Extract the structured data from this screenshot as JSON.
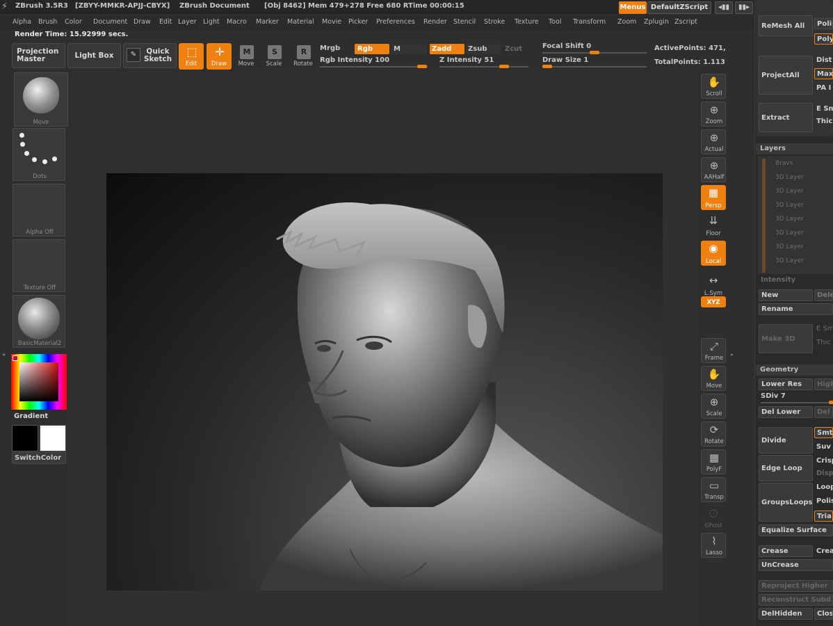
{
  "titlebar": {
    "app": "ZBrush 3.5R3",
    "serial": "[ZBYY-MMKR-APJJ-CBYX]",
    "document": "ZBrush Document",
    "stats": "[Obj 8462] Mem 479+278 Free 680 RTime 00:00:15",
    "menus_label": "Menus",
    "script_label": "DefaultZScript"
  },
  "menubar": [
    "Alpha",
    "Brush",
    "Color",
    "Document",
    "Draw",
    "Edit",
    "Layer",
    "Light",
    "Macro",
    "Marker",
    "Material",
    "Movie",
    "Picker",
    "Preferences",
    "Render",
    "Stencil",
    "Stroke",
    "Texture",
    "Tool",
    "Transform",
    "Zoom",
    "Zplugin",
    "Zscript"
  ],
  "status": {
    "render_time": "Render Time: 15.92999 secs."
  },
  "toolbar": {
    "projection_master": "Projection Master",
    "light_box": "Light Box",
    "quick_sketch": "Quick Sketch",
    "edit": "Edit",
    "draw": "Draw",
    "move": "Move",
    "scale": "Scale",
    "rotate": "Rotate",
    "mrgb": "Mrgb",
    "rgb": "Rgb",
    "m": "M",
    "zadd": "Zadd",
    "zsub": "Zsub",
    "zcut": "Zcut",
    "rgb_intensity": "Rgb Intensity 100",
    "z_intensity": "Z Intensity 51",
    "focal_shift": "Focal Shift 0",
    "draw_size": "Draw Size 1",
    "active_points": "ActivePoints: 471,",
    "total_points": "TotalPoints: 1.113"
  },
  "left_palette": {
    "tiles": [
      "Move",
      "Dots",
      "Alpha Off",
      "Texture Off",
      "BasicMaterial2"
    ],
    "gradient": "Gradient",
    "switch_color": "SwitchColor"
  },
  "right_shelf": [
    "Scroll",
    "Zoom",
    "Actual",
    "AAHalf",
    "Persp",
    "Floor",
    "Local",
    "L.Sym",
    "XYZ",
    "Frame",
    "Move",
    "Scale",
    "Rotate",
    "PolyF",
    "Transp",
    "Ghost",
    "Lasso"
  ],
  "right_panel": {
    "remesh_all": "ReMesh All",
    "polish": "Polis",
    "poly": "Poly",
    "projectall": "ProjectAll",
    "dist": "Dist",
    "maxi": "Maxi",
    "pa": "PA I",
    "extract": "Extract",
    "e_sm": "E Sm",
    "thick": "Thic",
    "layers_title": "Layers",
    "layers": [
      "Bravs",
      "3D Layer",
      "3D Layer",
      "3D Layer",
      "3D Layer",
      "3D Layer",
      "3D Layer",
      "3D Layer"
    ],
    "intensity": "Intensity",
    "new": "New",
    "delete": "Dele",
    "rename": "Rename",
    "make3d": "Make 3D",
    "e_sm2": "E Sm",
    "thick2": "Thic",
    "geometry_title": "Geometry",
    "lower_res": "Lower Res",
    "higher": "High",
    "sdiv": "SDiv 7",
    "del_lower": "Del Lower",
    "del_higher": "Del",
    "divide": "Divide",
    "smt": "Smt",
    "suv": "Suv",
    "edge_loop": "Edge Loop",
    "crisp": "Crisp",
    "disp": "Disp",
    "groups_loops": "GroupsLoops",
    "loops": "Loop",
    "polish2": "Polis",
    "tria": "Tria",
    "equalize": "Equalize Surface",
    "crease": "Crease",
    "crea": "Crea",
    "uncrease": "UnCrease",
    "reproject": "Reproject Higher",
    "reconstruct": "Reconstruct Subd",
    "delhidden": "DelHidden",
    "close": "Close"
  },
  "colors": {
    "accent": "#f08010",
    "bg": "#2e2e2e",
    "panel": "#383838"
  }
}
